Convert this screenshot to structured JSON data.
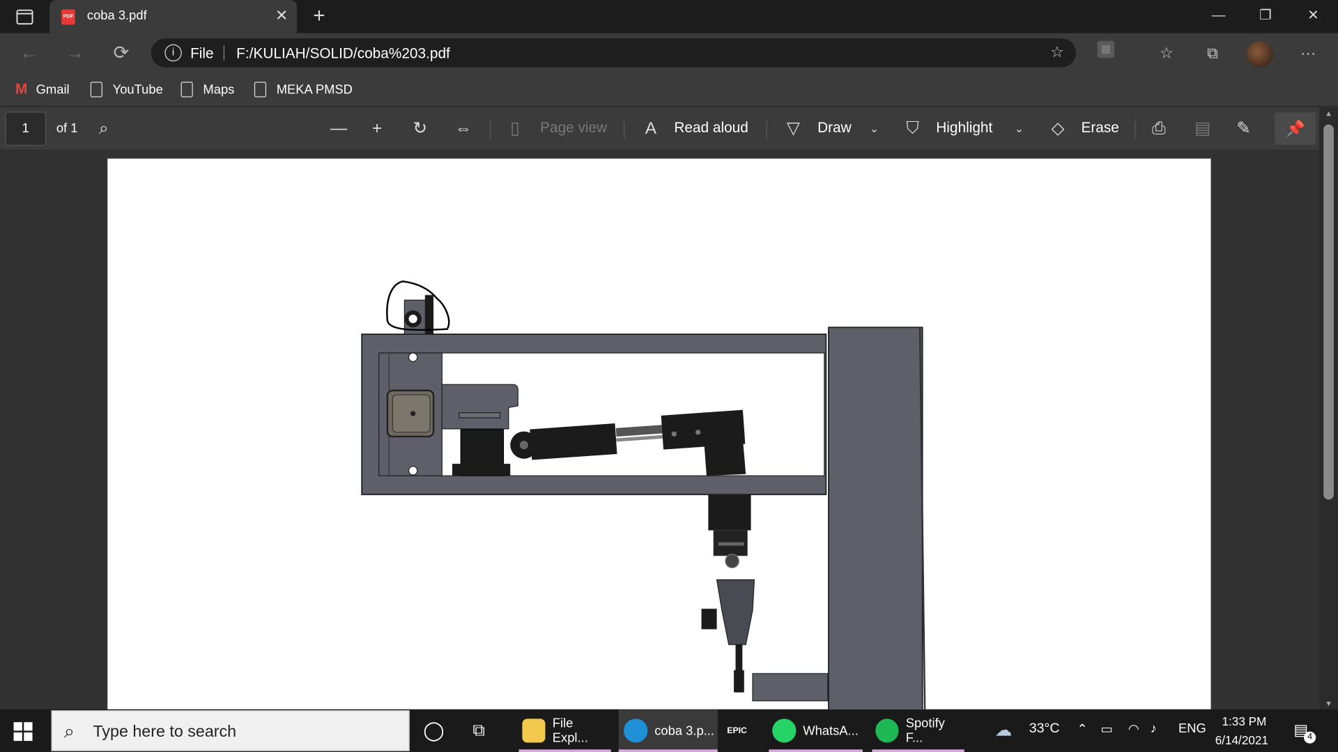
{
  "browser": {
    "tab_title": "coba 3.pdf",
    "tab_icon_label": "PDF",
    "address_scheme": "File",
    "address_url": "F:/KULIAH/SOLID/coba%203.pdf"
  },
  "bookmarks": [
    {
      "label": "Gmail"
    },
    {
      "label": "YouTube"
    },
    {
      "label": "Maps"
    },
    {
      "label": "MEKA PMSD"
    }
  ],
  "pdf_toolbar": {
    "page_number": "1",
    "page_total": "of 1",
    "page_view_label": "Page view",
    "read_aloud_label": "Read aloud",
    "draw_label": "Draw",
    "highlight_label": "Highlight",
    "erase_label": "Erase"
  },
  "taskbar": {
    "search_placeholder": "Type here to search",
    "apps": [
      {
        "label": "File Expl...",
        "color": "#f2c94c"
      },
      {
        "label": "coba 3.p...",
        "color": "#1e90d6"
      },
      {
        "label": "EPIC",
        "color": "#2a2a2a"
      },
      {
        "label": "WhatsA...",
        "color": "#25d366"
      },
      {
        "label": "Spotify F...",
        "color": "#1db954"
      }
    ],
    "weather": "33°C",
    "language": "ENG",
    "time": "1:33 PM",
    "date": "6/14/2021",
    "notifications": "4"
  },
  "colors": {
    "titlebar": "#1c1c1c",
    "toolbar": "#3b3b3b",
    "viewer_bg": "#323232",
    "frame_gray": "#5e5f68",
    "frame_dark": "#1b1b1b"
  }
}
